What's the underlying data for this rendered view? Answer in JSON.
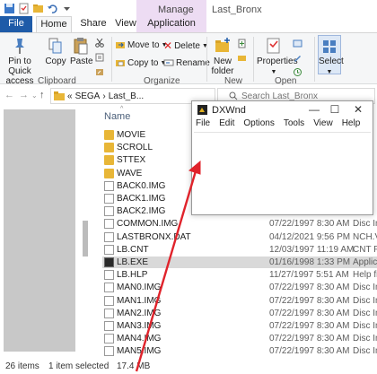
{
  "titlebar": {
    "manage_label": "Manage",
    "window_title": "Last_Bronx",
    "quick_access": [
      "save-icon",
      "properties-icon",
      "new-folder-icon",
      "undo-icon",
      "customize-icon"
    ]
  },
  "tabs": {
    "file": "File",
    "home": "Home",
    "share": "Share",
    "view": "View",
    "app_tools": "Application Tools"
  },
  "ribbon": {
    "pin_label_1": "Pin to Quick",
    "pin_label_2": "access",
    "copy": "Copy",
    "paste": "Paste",
    "clipboard_group": "Clipboard",
    "move_to": "Move to",
    "copy_to": "Copy to",
    "delete": "Delete",
    "rename": "Rename",
    "organize_group": "Organize",
    "new_folder_1": "New",
    "new_folder_2": "folder",
    "new_group": "New",
    "properties": "Properties",
    "open_group": "Open",
    "select": "Select"
  },
  "address": {
    "chevrons": "«",
    "path_root": "SEGA",
    "path_sep": "›",
    "path_leaf": "Last_B...",
    "search_placeholder": "Search Last_Bronx"
  },
  "list": {
    "column_name": "Name",
    "rows": [
      {
        "name": "MOVIE",
        "kind": "folder",
        "date": "",
        "type": ""
      },
      {
        "name": "SCROLL",
        "kind": "folder",
        "date": "",
        "type": ""
      },
      {
        "name": "STTEX",
        "kind": "folder",
        "date": "",
        "type": ""
      },
      {
        "name": "WAVE",
        "kind": "folder",
        "date": "",
        "type": ""
      },
      {
        "name": "BACK0.IMG",
        "kind": "file",
        "date": "",
        "type": ""
      },
      {
        "name": "BACK1.IMG",
        "kind": "file",
        "date": "",
        "type": ""
      },
      {
        "name": "BACK2.IMG",
        "kind": "file",
        "date": "",
        "type": ""
      },
      {
        "name": "COMMON.IMG",
        "kind": "file",
        "date": "07/22/1997 8:30 AM",
        "type": "Disc Im"
      },
      {
        "name": "LASTBRONX.DAT",
        "kind": "file",
        "date": "04/12/2021 9:56 PM",
        "type": "NCH.V"
      },
      {
        "name": "LB.CNT",
        "kind": "file",
        "date": "12/03/1997 11:19 AM",
        "type": "CNT Fi"
      },
      {
        "name": "LB.EXE",
        "kind": "exe",
        "date": "01/16/1998 1:33 PM",
        "type": "Applica",
        "selected": true
      },
      {
        "name": "LB.HLP",
        "kind": "file",
        "date": "11/27/1997 5:51 AM",
        "type": "Help fi"
      },
      {
        "name": "MAN0.IMG",
        "kind": "file",
        "date": "07/22/1997 8:30 AM",
        "type": "Disc Im"
      },
      {
        "name": "MAN1.IMG",
        "kind": "file",
        "date": "07/22/1997 8:30 AM",
        "type": "Disc Im"
      },
      {
        "name": "MAN2.IMG",
        "kind": "file",
        "date": "07/22/1997 8:30 AM",
        "type": "Disc Im"
      },
      {
        "name": "MAN3.IMG",
        "kind": "file",
        "date": "07/22/1997 8:30 AM",
        "type": "Disc Im"
      },
      {
        "name": "MAN4.IMG",
        "kind": "file",
        "date": "07/22/1997 8:30 AM",
        "type": "Disc Im"
      },
      {
        "name": "MAN5.IMG",
        "kind": "file",
        "date": "07/22/1997 8:30 AM",
        "type": "Disc Im"
      }
    ]
  },
  "status": {
    "items": "26 items",
    "selected": "1 item selected",
    "size": "17.4 MB"
  },
  "dxwnd": {
    "title": "DXWnd",
    "minimize": "—",
    "maximize": "☐",
    "close": "✕",
    "menu": [
      "File",
      "Edit",
      "Options",
      "Tools",
      "View",
      "Help"
    ]
  },
  "colors": {
    "file_tab": "#1e5ba8",
    "manage_band": "#eddcf3",
    "arrow": "#e0232b",
    "selection": "#d9d9d9"
  }
}
